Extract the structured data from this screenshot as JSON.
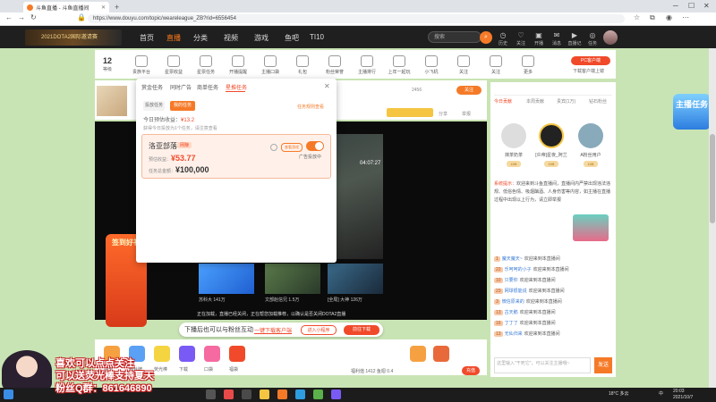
{
  "browser": {
    "tab_title": "斗鱼直播 - 斗鱼直播间",
    "url": "https://www.douyu.com/topic/weareleague_ZB?rid=6556454"
  },
  "topnav": {
    "banner": "2021DOTA2国际邀请赛",
    "items": [
      "首页",
      "直播",
      "分类",
      "视频",
      "游戏",
      "鱼吧",
      "TI10"
    ],
    "search_placeholder": "搜索",
    "user_icons": [
      "历史",
      "关注",
      "开播",
      "消息",
      "直播记",
      "任务"
    ]
  },
  "subbar": {
    "level": "12",
    "level_sub": "等级",
    "items": [
      "贵族平台",
      "星票收益",
      "星票任务",
      "开播提醒",
      "主播口袋",
      "礼包",
      "粉丝荣誉",
      "主播排行",
      "上年一起玩",
      "小飞机",
      "关注",
      "关注",
      "更多"
    ],
    "pc_button": "PC客户端",
    "pc_sub": "下载客户端上镜"
  },
  "room": {
    "stream_title": "主播",
    "viewer_count": "2456",
    "follow_btn": "关注",
    "share": "分享",
    "report": "举报",
    "clock": "04:07:27",
    "promo": "签到好礼",
    "thumbnails": [
      {
        "caption": "苏科大",
        "views": "141万"
      },
      {
        "caption": "文部赵信兄",
        "views": "1.5万"
      },
      {
        "caption": "[全局] 大神",
        "views": "126万"
      }
    ],
    "ticker": "正在加载，直播已经关闭，正在帮您加载推荐，以确认是否关闭DOTA2直播"
  },
  "toast": {
    "text": "下播后也可以与粉丝互动",
    "link": "一键下载客户端",
    "btn1": "进入小程序",
    "btn2": "前往下载"
  },
  "gifts": {
    "labels": [
      "办卡",
      "粉丝牌",
      "荧光棒",
      "下载",
      "口袋",
      "福袋"
    ],
    "fans": "福利值",
    "fans_count": "1412",
    "gold": "鱼翅 0.4",
    "charge": "充值"
  },
  "right": {
    "tabs": [
      "今日贡献",
      "本周贡献",
      "贵宾(1万)",
      "钻石粉丝"
    ],
    "top_users": [
      {
        "name": "抹茶奶茶",
        "level": "LV8"
      },
      {
        "name": "[炎帝]星夜_阿兰",
        "level": "LV8"
      },
      {
        "name": "A粉丝用户",
        "level": "LV8"
      }
    ],
    "system_label": "系统提示：",
    "system_msg": "欢迎来到斗鱼直播间，直播间内严禁出现违法违规、低俗色情、吸烟酗酒、人身伤害等内容，如主播在直播过程中出现以上行为，请立即举报",
    "chat": [
      {
        "lv": "1",
        "name": "魔天魔天~",
        "text": "欢迎来到本直播间"
      },
      {
        "lv": "22",
        "name": "乐呵呵的小子",
        "text": "欢迎来到本直播间"
      },
      {
        "lv": "10",
        "name": "只要你",
        "text": "欢迎来到本直播间"
      },
      {
        "lv": "23",
        "name": "网球很能说",
        "text": "欢迎来到本直播间"
      },
      {
        "lv": "3",
        "name": "微信原来的",
        "text": "欢迎来到本直播间"
      },
      {
        "lv": "13",
        "name": "古天鹅",
        "text": "欢迎来到本直播间"
      },
      {
        "lv": "16",
        "name": "丁丁了",
        "text": "欢迎来到本直播间"
      },
      {
        "lv": "13",
        "name": "无仙归来",
        "text": "欢迎来到本直播间"
      }
    ],
    "input_placeholder": "这里输入\"干死它\"，可以关注主播哦~",
    "send": "发送",
    "promo": "主播任务"
  },
  "popup": {
    "tabs": [
      "赏金任务",
      "同时广告",
      "商单任务",
      "星推任务"
    ],
    "sub_tabs": [
      "投放任务",
      "我的任务"
    ],
    "link": "任务规则查看",
    "income_label": "今日预估收益：",
    "income_value": "¥13.2",
    "note": "获得今日投放为1个任务，请注意查看",
    "card": {
      "name": "洛亚部落",
      "tag": "网赚",
      "preview": "查看游戏",
      "toggle_label": "广告投放中",
      "est_label": "预估收益：",
      "est_value": "¥53.77",
      "total_label": "任务总金额：",
      "total_value": "¥100,000"
    }
  },
  "overlay": {
    "line1": "喜欢可以点点关注",
    "line2": "可以送荧光棒支持夏天",
    "line3": "粉丝Q群：861646890"
  },
  "taskbar": {
    "weather": "18°C 多云",
    "lang": "中",
    "time": "20:03",
    "date": "2021/10/7"
  },
  "colors": {
    "accent": "#f57a28",
    "brand_red": "#f04a2a",
    "background": "#c9e4b4"
  }
}
